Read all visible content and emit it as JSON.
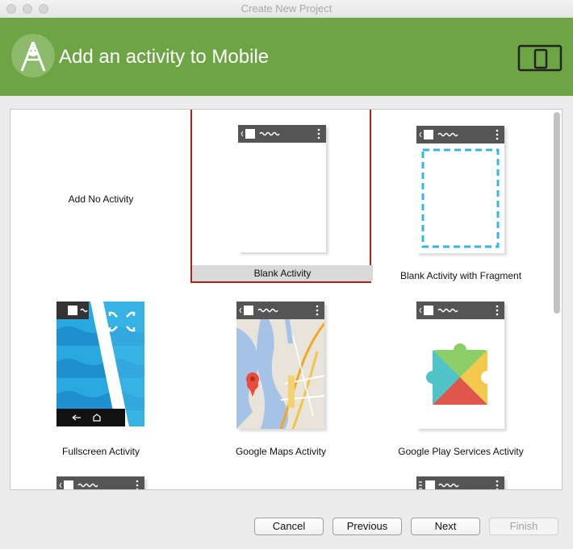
{
  "window": {
    "title": "Create New Project"
  },
  "header": {
    "title": "Add an activity to Mobile",
    "accent": "#6da545"
  },
  "gallery": {
    "items": [
      {
        "label": "Add No Activity",
        "selected": false
      },
      {
        "label": "Blank Activity",
        "selected": true
      },
      {
        "label": "Blank Activity with Fragment",
        "selected": false
      },
      {
        "label": "Fullscreen Activity",
        "selected": false
      },
      {
        "label": "Google Maps Activity",
        "selected": false
      },
      {
        "label": "Google Play Services Activity",
        "selected": false
      }
    ]
  },
  "buttons": {
    "cancel": "Cancel",
    "previous": "Previous",
    "next": "Next",
    "finish": "Finish"
  }
}
